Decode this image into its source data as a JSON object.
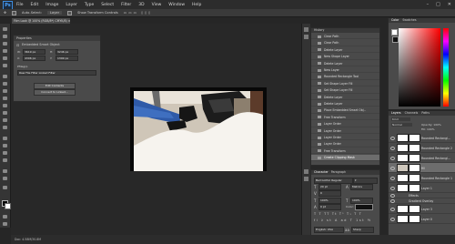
{
  "app": {
    "logo": "Ps"
  },
  "menu": [
    "File",
    "Edit",
    "Image",
    "Layer",
    "Type",
    "Select",
    "Filter",
    "3D",
    "View",
    "Window",
    "Help"
  ],
  "window_controls": [
    "–",
    "□",
    "✕"
  ],
  "options_bar": {
    "auto_select": "Auto-Select:",
    "layer_select": "Layer",
    "show_transform": "Show Transform Controls"
  },
  "document_tab": "Film Look @ 100% (RGB/8*) CMYK/8) ×",
  "properties": {
    "title": "Properties",
    "object_type": "Embedded Smart Object",
    "w_label": "W:",
    "w_value": "3619 px",
    "h_label": "H:",
    "h_value": "3246 px",
    "x_label": "X:",
    "x_value": "4306 px",
    "y_label": "Y:",
    "y_value": "1399 px",
    "file_label": "Pfilegrp",
    "file_value": "Raw File  Filter Linked Filter",
    "edit_button": "Edit Contents",
    "convert_button": "Convert to Linked..."
  },
  "history": {
    "title": "History",
    "items": [
      "Clear Path",
      "Clear Path",
      "Delete Layer",
      "New Shape Layer",
      "Delete Layer",
      "New Layer",
      "Rounded Rectangle Tool",
      "Set Shape Layer Fill",
      "Set Shape Layer Fill",
      "Delete Layer",
      "Delete Layer",
      "Place Embedded Smart Obj..",
      "Free Transform",
      "Layer Order",
      "Layer Order",
      "Layer Order",
      "Layer Order",
      "Free Transform",
      "Create Clipping Mask"
    ],
    "selected_index": 18
  },
  "character": {
    "tabs": [
      "Character",
      "Paragraph"
    ],
    "font": "Bell Gothic Regular",
    "size": "20 pt",
    "leading": "Metrics",
    "tracking": "0",
    "vscale": "100%",
    "hscale": "100%",
    "baseline": "0 pt",
    "color_label": "Color:",
    "language": "English: USA",
    "aa": "Sharp"
  },
  "color_panel": {
    "tabs": [
      "Color",
      "Swatches"
    ]
  },
  "layers": {
    "tabs": [
      "Layers",
      "Channels",
      "Paths"
    ],
    "kind": "Kind",
    "blend": "Normal",
    "opacity": "Opacity: 100%",
    "fill": "Fill: 100%",
    "rows": [
      {
        "name": "Rounded Rectangl...",
        "selected": false,
        "thumb_color": "#ffffff"
      },
      {
        "name": "Rounded Rectangle 2",
        "selected": false,
        "thumb_color": "#ffffff"
      },
      {
        "name": "Rounded Rectangl...",
        "selected": false,
        "thumb_color": "#ffffff"
      },
      {
        "name": "fill",
        "selected": true,
        "thumb_color": "#cfc8bd"
      },
      {
        "name": "Rounded Rectangle 1",
        "selected": false,
        "thumb_color": "#ffffff"
      },
      {
        "name": "Layer 1",
        "selected": false,
        "thumb_color": "#ffffff"
      },
      {
        "name": "Effects",
        "selected": false,
        "thumb_color": "#ffffff"
      },
      {
        "name": "Gradient Overlay",
        "selected": false,
        "thumb_color": "#ffffff"
      },
      {
        "name": "Layer 3",
        "selected": false,
        "thumb_color": "#ffffff"
      },
      {
        "name": "Layer 0",
        "selected": false,
        "thumb_color": "#ffffff"
      }
    ]
  },
  "status": "Doc: 4.58M/30.8M"
}
